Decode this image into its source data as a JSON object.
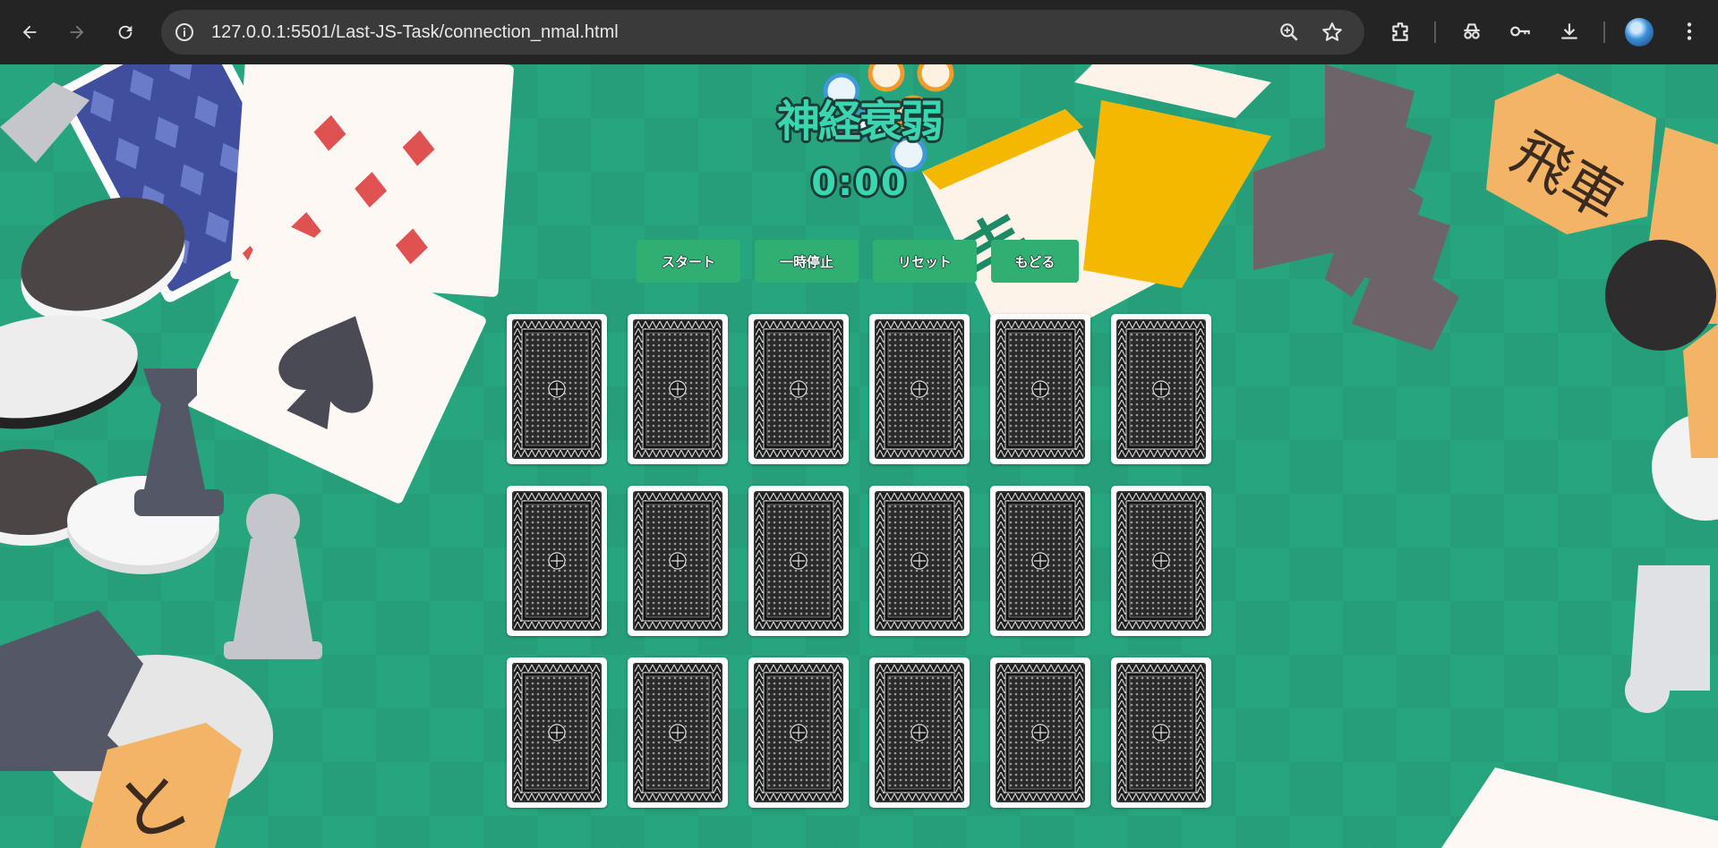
{
  "browser": {
    "url_host": "127.0.0.1:5501/",
    "url_path": "Last-JS-Task/connection_nmal.html",
    "icons": [
      "back-icon",
      "forward-icon",
      "reload-icon",
      "site-info-icon",
      "zoom-icon",
      "bookmark-star-icon",
      "extensions-icon",
      "incognito-icon",
      "password-key-icon",
      "download-icon",
      "profile-avatar",
      "menu-dots-icon"
    ]
  },
  "game": {
    "title": "神経衰弱",
    "timer": "0:00",
    "buttons": {
      "start": "スタート",
      "pause": "一時停止",
      "reset": "リセット",
      "back": "もどる"
    },
    "card_count": 18,
    "card_state": "face-down",
    "colors": {
      "background": "#27a57e",
      "title_fill": "#3ad6b0",
      "button": "#2fb072"
    }
  }
}
